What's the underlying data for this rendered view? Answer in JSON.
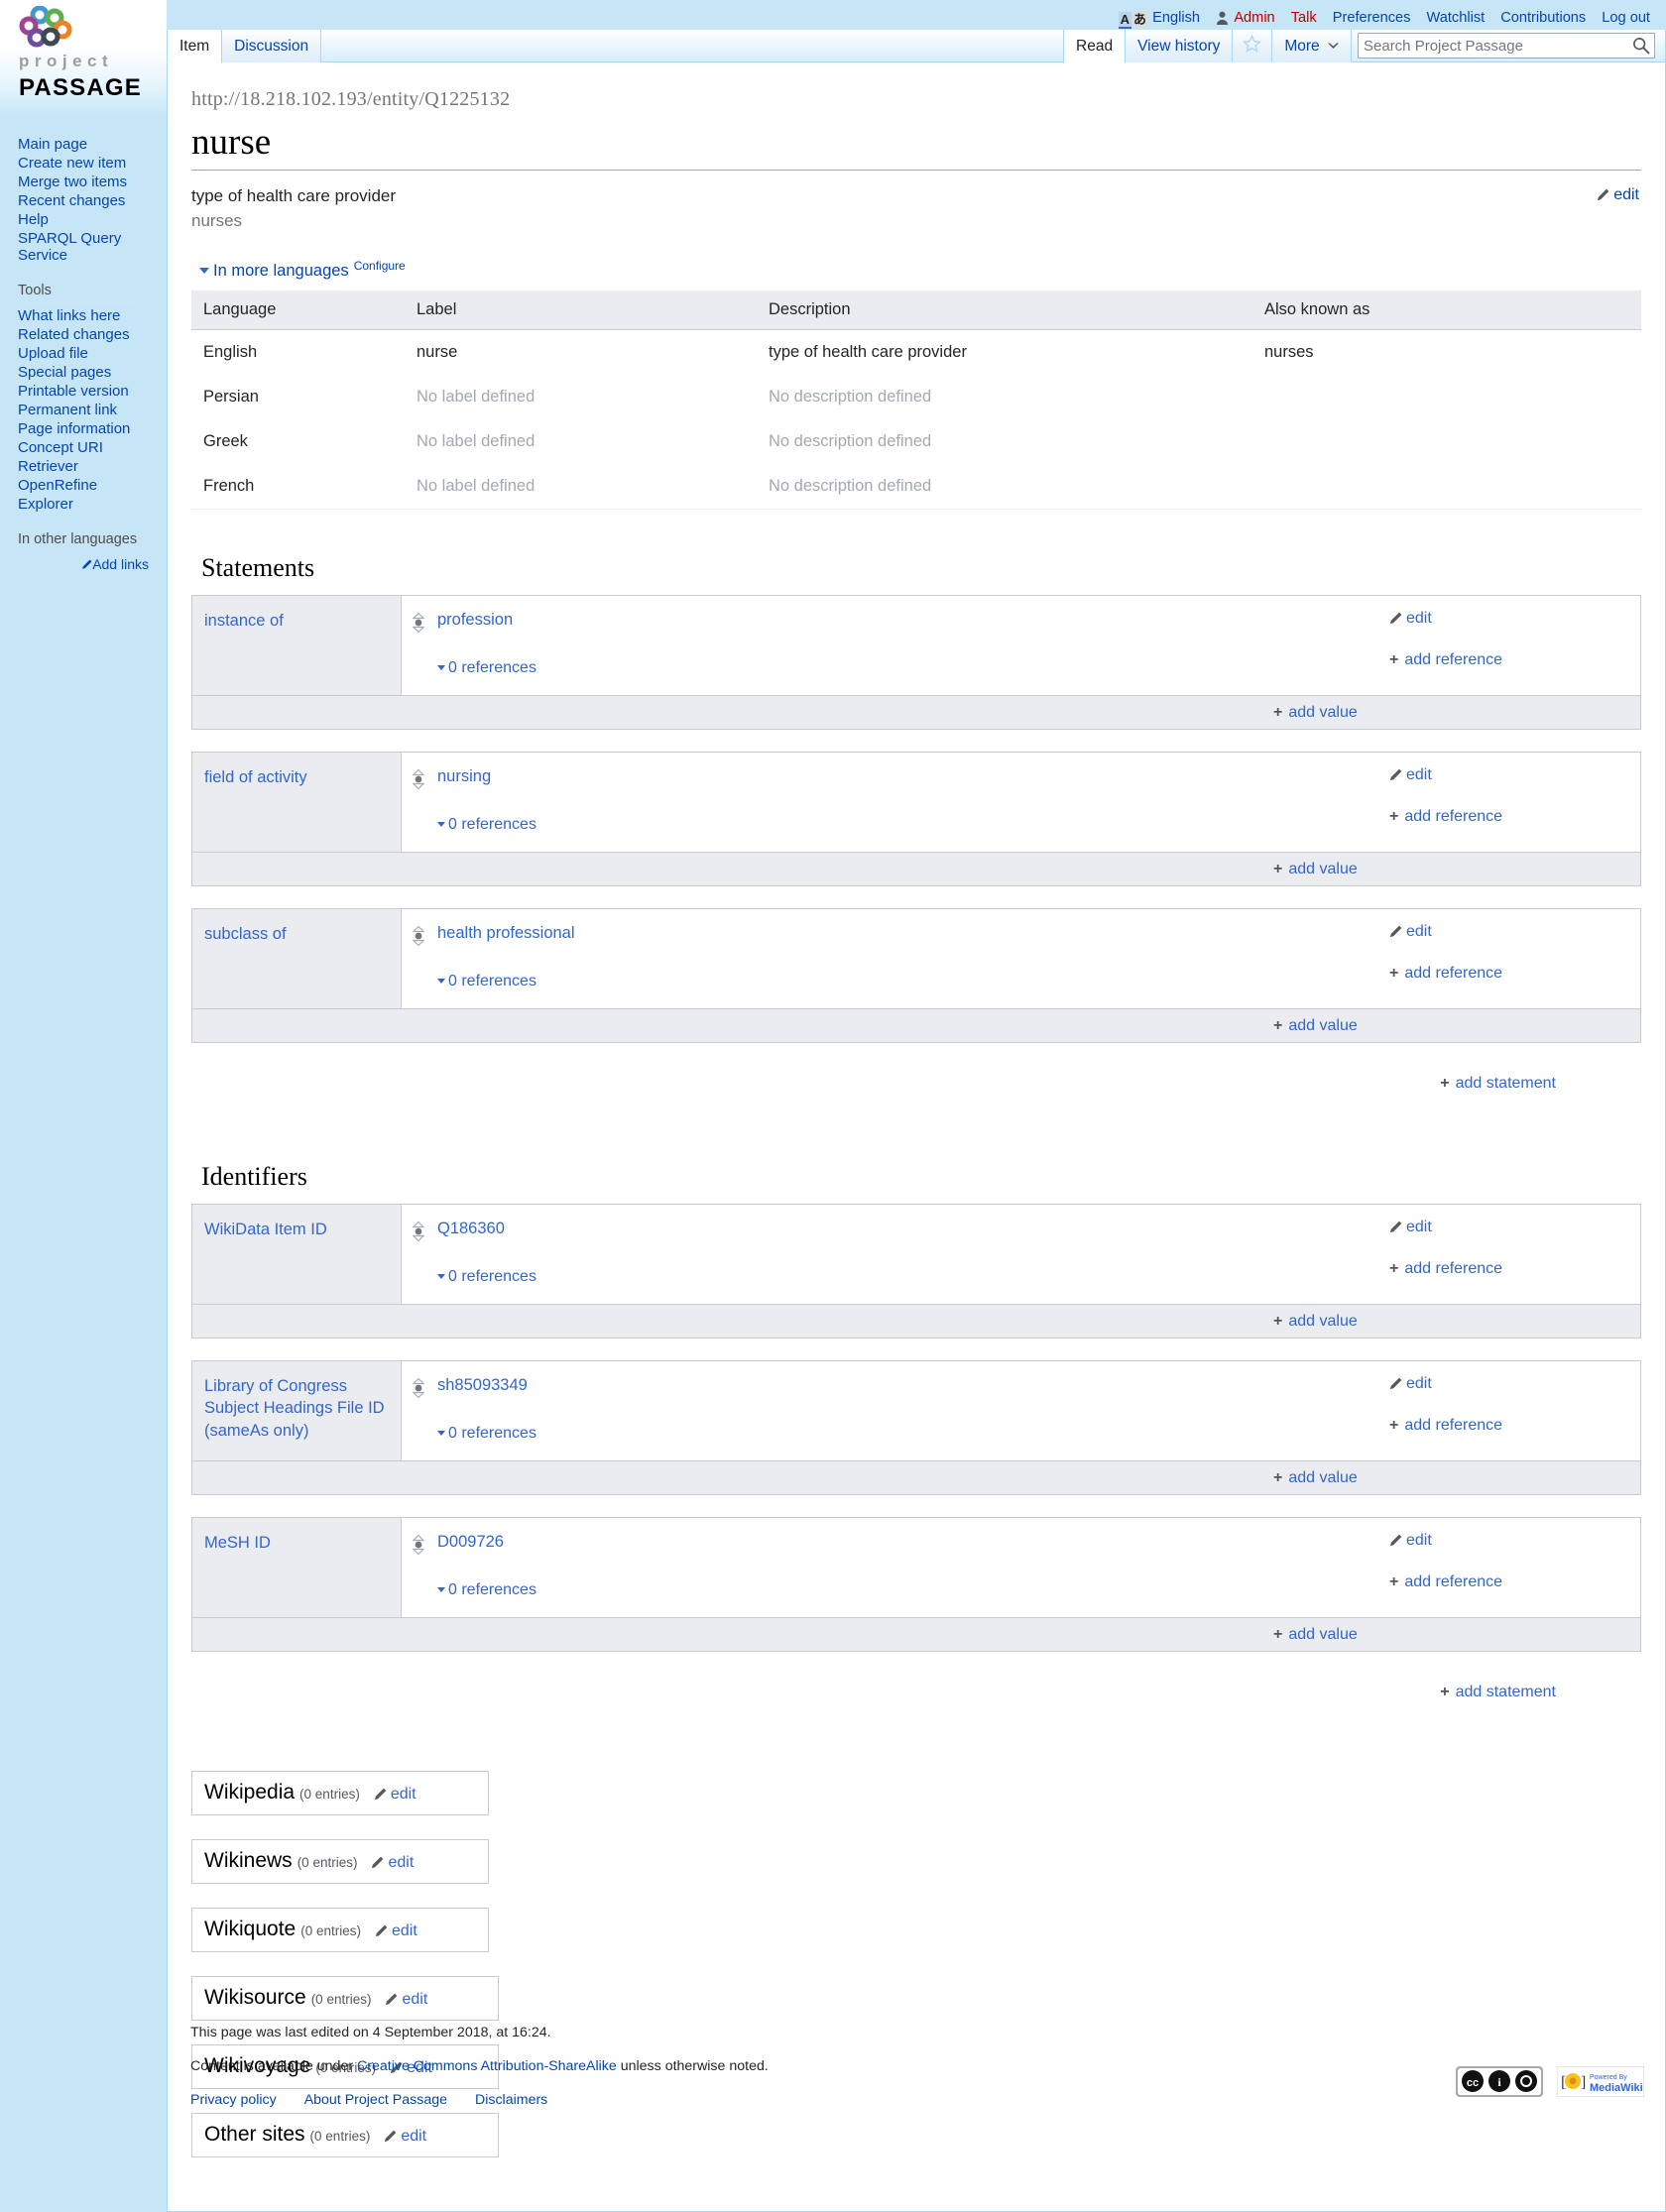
{
  "site": {
    "logo_project": "project",
    "logo_passage": "PASSAGE",
    "logo_icon": "project-passage-logo-icon"
  },
  "personal_bar": {
    "lang_badge_icon": "language-variant-icon",
    "language": "English",
    "user_icon": "user-avatar-icon",
    "username": "Admin",
    "items": [
      "Talk",
      "Preferences",
      "Watchlist",
      "Contributions",
      "Log out"
    ]
  },
  "tabs": {
    "namespaces": [
      {
        "label": "Item",
        "selected": true
      },
      {
        "label": "Discussion",
        "selected": false
      }
    ],
    "views": [
      {
        "label": "Read",
        "selected": true
      },
      {
        "label": "View history",
        "selected": false
      }
    ],
    "watch_icon": "star-outline-icon",
    "more": {
      "label": "More",
      "icon": "chevron-down-icon"
    }
  },
  "search": {
    "placeholder": "Search Project Passage",
    "value": "",
    "icon": "search-icon"
  },
  "sidebar": {
    "navigation": [
      "Main page",
      "Create new item",
      "Merge two items",
      "Recent changes",
      "Help",
      "SPARQL Query Service"
    ],
    "tools_heading": "Tools",
    "tools": [
      "What links here",
      "Related changes",
      "Upload file",
      "Special pages",
      "Printable version",
      "Permanent link",
      "Page information",
      "Concept URI",
      "Retriever",
      "OpenRefine",
      "Explorer"
    ],
    "other_languages_heading": "In other languages",
    "add_links": "Add links",
    "add_links_icon": "pencil-icon"
  },
  "entity": {
    "uri": "http://18.218.102.193/entity/Q1225132",
    "title": "nurse",
    "description": "type of health care provider",
    "aliases": "nurses",
    "edit_label": "edit",
    "edit_icon": "pencil-icon"
  },
  "more_languages": {
    "toggle_label": "In more languages",
    "toggle_icon": "caret-down-icon",
    "configure_label": "Configure",
    "columns": [
      "Language",
      "Label",
      "Description",
      "Also known as"
    ],
    "rows": [
      {
        "language": "English",
        "label": "nurse",
        "label_empty": false,
        "description": "type of health care provider",
        "description_empty": false,
        "also_known_as": "nurses"
      },
      {
        "language": "Persian",
        "label": "No label defined",
        "label_empty": true,
        "description": "No description defined",
        "description_empty": true,
        "also_known_as": ""
      },
      {
        "language": "Greek",
        "label": "No label defined",
        "label_empty": true,
        "description": "No description defined",
        "description_empty": true,
        "also_known_as": ""
      },
      {
        "language": "French",
        "label": "No label defined",
        "label_empty": true,
        "description": "No description defined",
        "description_empty": true,
        "also_known_as": ""
      }
    ]
  },
  "statements": {
    "heading": "Statements",
    "groups": [
      {
        "property": "instance of",
        "value": "profession",
        "references_label": "0 references",
        "edit_label": "edit",
        "add_reference_label": "add reference",
        "add_value_label": "add value",
        "rank_icon": "normal-rank-icon"
      },
      {
        "property": "field of activity",
        "value": "nursing",
        "references_label": "0 references",
        "edit_label": "edit",
        "add_reference_label": "add reference",
        "add_value_label": "add value",
        "rank_icon": "normal-rank-icon"
      },
      {
        "property": "subclass of",
        "value": "health professional",
        "references_label": "0 references",
        "edit_label": "edit",
        "add_reference_label": "add reference",
        "add_value_label": "add value",
        "rank_icon": "normal-rank-icon"
      }
    ],
    "add_statement_label": "add statement"
  },
  "identifiers": {
    "heading": "Identifiers",
    "groups": [
      {
        "property": "WikiData Item ID",
        "value": "Q186360",
        "references_label": "0 references",
        "edit_label": "edit",
        "add_reference_label": "add reference",
        "add_value_label": "add value",
        "rank_icon": "normal-rank-icon"
      },
      {
        "property": "Library of Congress Subject Headings File ID (sameAs only)",
        "value": "sh85093349",
        "references_label": "0 references",
        "edit_label": "edit",
        "add_reference_label": "add reference",
        "add_value_label": "add value",
        "rank_icon": "normal-rank-icon"
      },
      {
        "property": "MeSH ID",
        "value": "D009726",
        "references_label": "0 references",
        "edit_label": "edit",
        "add_reference_label": "add reference",
        "add_value_label": "add value",
        "rank_icon": "normal-rank-icon"
      }
    ],
    "add_statement_label": "add statement"
  },
  "sitelinks": [
    {
      "name": "Wikipedia",
      "count": "(0 entries)",
      "edit_label": "edit"
    },
    {
      "name": "Wikinews",
      "count": "(0 entries)",
      "edit_label": "edit"
    },
    {
      "name": "Wikiquote",
      "count": "(0 entries)",
      "edit_label": "edit"
    },
    {
      "name": "Wikisource",
      "count": "(0 entries)",
      "edit_label": "edit"
    },
    {
      "name": "Wikivoyage",
      "count": "(0 entries)",
      "edit_label": "edit"
    },
    {
      "name": "Other sites",
      "count": "(0 entries)",
      "edit_label": "edit"
    }
  ],
  "footer": {
    "last_edited": "This page was last edited on 4 September 2018, at 16:24.",
    "license_prefix": "Content is available under ",
    "license_link": "Creative Commons Attribution-ShareAlike",
    "license_suffix": " unless otherwise noted.",
    "links": [
      "Privacy policy",
      "About Project Passage",
      "Disclaimers"
    ],
    "cc_badge": "creative-commons-badge-icon",
    "mediawiki_badge": "powered-by-mediawiki-badge-icon",
    "mediawiki_badge_text": "Powered By MediaWiki"
  },
  "colors": {
    "chrome_blue": "#c6e6f7",
    "link_blue": "#0645ad",
    "wikibase_link": "#36c",
    "red_link": "#ba0000",
    "panel_grey": "#eaecf0",
    "border_grey": "#c8ccd1"
  }
}
